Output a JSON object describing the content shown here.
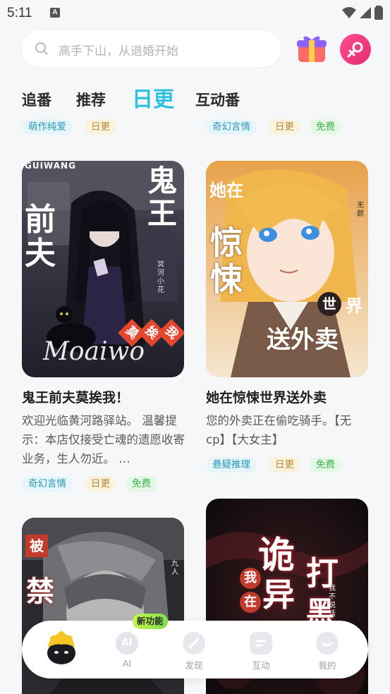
{
  "status_bar": {
    "time": "5:11"
  },
  "search": {
    "placeholder": "高手下山，从退婚开始"
  },
  "tabs": [
    {
      "label": "追番",
      "active": false
    },
    {
      "label": "推荐",
      "active": false
    },
    {
      "label": "日更",
      "active": true
    },
    {
      "label": "互动番",
      "active": false
    }
  ],
  "top_row_tags": {
    "left": [
      "萌作纯爱",
      "日更"
    ],
    "right": [
      "奇幻言情",
      "日更",
      "免费"
    ]
  },
  "cards": [
    {
      "title": "鬼王前夫莫挨我！",
      "cover_text": [
        "前夫",
        "鬼王",
        "莫",
        "挨",
        "我",
        "Moaiwo",
        "GUIWANG",
        "冥河小花"
      ],
      "description": "欢迎光临黄河路驿站。 温馨提示：本店仅接受亡魂的遗愿收寄业务，生人勿近。 …",
      "tags": [
        "奇幻言情",
        "日更",
        "免费"
      ]
    },
    {
      "title": "她在惊悚世界送外卖",
      "cover_text": [
        "她在",
        "惊悚",
        "世",
        "界",
        "送外卖",
        "无颜"
      ],
      "description": "您的外卖正在偷吃骑手。【无cp】【大女主】",
      "tags": [
        "悬疑推理",
        "日更",
        "免费"
      ]
    },
    {
      "title": "",
      "cover_text": [
        "被",
        "禁",
        "九人"
      ]
    },
    {
      "title": "",
      "cover_text": [
        "诡",
        "异",
        "打",
        "黑",
        "我",
        "在",
        "我不说话"
      ]
    }
  ],
  "colors": {
    "accent": "#2ec1e0",
    "tag_blue": "#2a98b8",
    "tag_gold": "#b28a36",
    "tag_green": "#3bb14a"
  },
  "bottom_nav": {
    "badge": "新功能",
    "items": [
      {
        "label": "AI",
        "icon": "ai-icon"
      },
      {
        "label": "发现",
        "icon": "discover-icon"
      },
      {
        "label": "互动",
        "icon": "interact-icon"
      },
      {
        "label": "我的",
        "icon": "profile-icon"
      }
    ]
  }
}
